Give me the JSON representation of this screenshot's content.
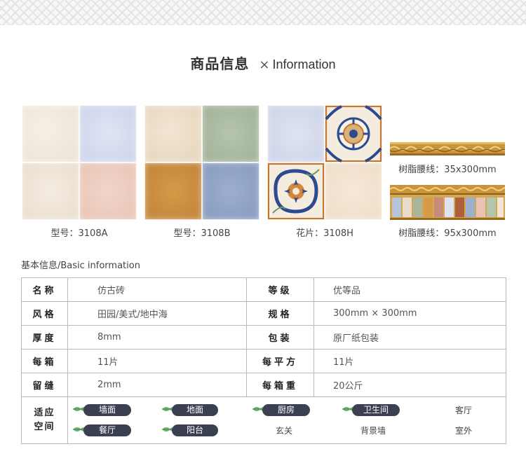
{
  "header": {
    "title_cn": "商品信息",
    "x_mark": "×",
    "title_en": "Information"
  },
  "products": [
    {
      "caption": "型号：3108A"
    },
    {
      "caption": "型号：3108B"
    },
    {
      "caption": "花片：3108H"
    }
  ],
  "trims": [
    {
      "caption": "树脂腰线：35x300mm"
    },
    {
      "caption": "树脂腰线：95x300mm"
    }
  ],
  "colors": {
    "chip_bg": "#3b3f52",
    "leaf_green": "#6fb36f",
    "table_border": "#b9b9b9",
    "pattern_blue": "#2d4a8f",
    "pattern_orange": "#c9742b"
  },
  "basic_info": {
    "label": "基本信息/Basic information",
    "rows": [
      {
        "k1": "名称",
        "v1": "仿古砖",
        "k2": "等级",
        "v2": "优等品"
      },
      {
        "k1": "风格",
        "v1": "田园/美式/地中海",
        "k2": "规格",
        "v2": "300mm × 300mm"
      },
      {
        "k1": "厚度",
        "v1": "8mm",
        "k2": "包装",
        "v2": "原厂纸包装"
      },
      {
        "k1": "每箱",
        "v1": "11片",
        "k2": "每平方",
        "v2": "11片"
      },
      {
        "k1": "留缝",
        "v1": "2mm",
        "k2": "每箱重",
        "v2": "20公斤"
      }
    ],
    "suitable": {
      "label_line1": "适应",
      "label_line2": "空间",
      "highlighted": [
        "墙面",
        "地面",
        "厨房",
        "卫生间",
        "餐厅",
        "阳台"
      ],
      "plain": [
        "客厅",
        "玄关",
        "背景墙",
        "室外"
      ]
    }
  }
}
